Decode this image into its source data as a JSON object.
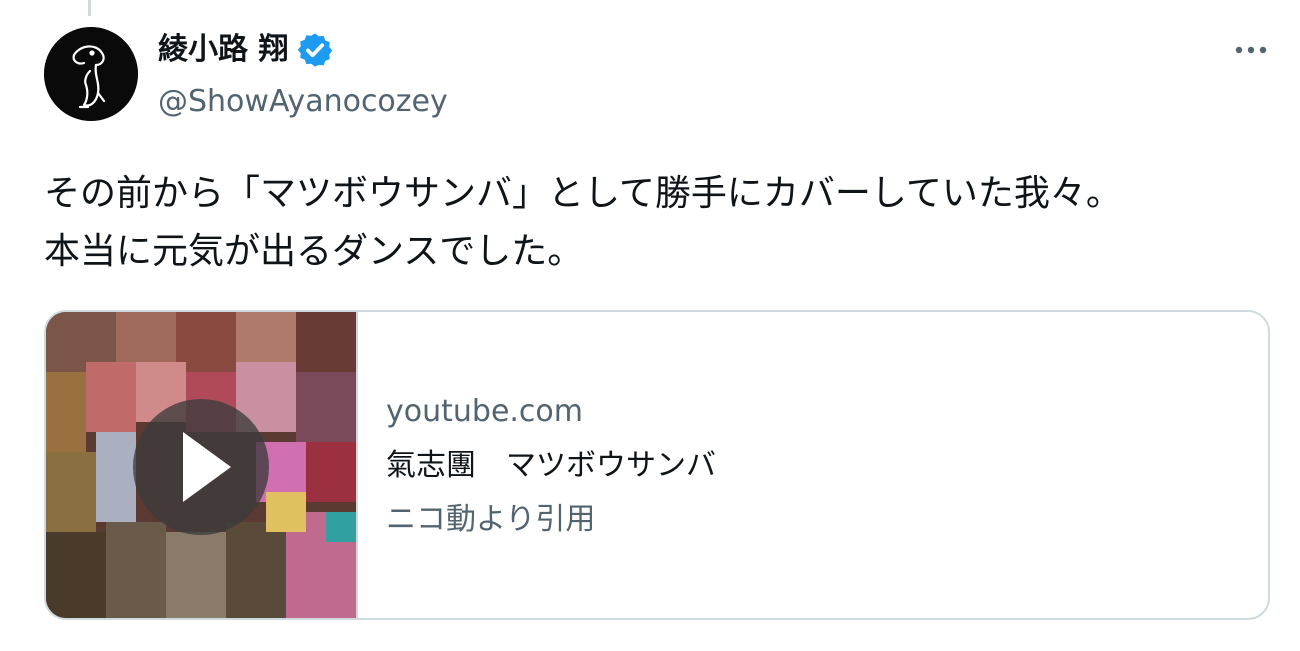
{
  "author": {
    "display_name": "綾小路 翔",
    "handle": "@ShowAyanocozey",
    "verified": true,
    "avatar_icon": "cartoon-dog-silhouette-icon"
  },
  "actions": {
    "more_icon": "more-horizontal-icon"
  },
  "tweet": {
    "lines": [
      "その前から「マツボウサンバ」として勝手にカバーしていた我々。",
      "本当に元気が出るダンスでした。"
    ]
  },
  "link_card": {
    "domain": "youtube.com",
    "title": "氣志團　マツボウサンバ",
    "description": "ニコ動より引用",
    "thumbnail_icon": "play-icon"
  },
  "colors": {
    "text": "#0f1419",
    "secondary": "#536471",
    "border": "#cfd9de",
    "verified_blue": "#1d9bf0"
  }
}
